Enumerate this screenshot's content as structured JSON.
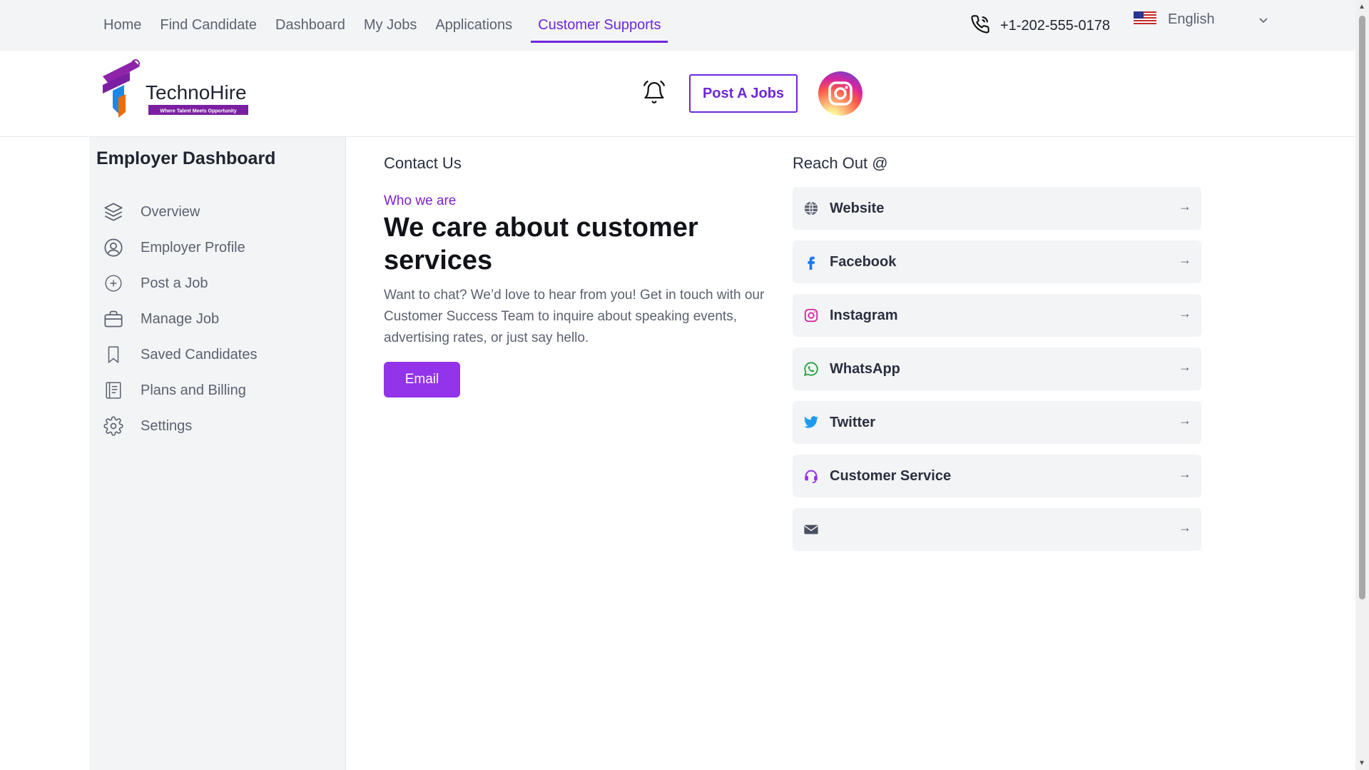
{
  "nav": {
    "items": [
      "Home",
      "Find Candidate",
      "Dashboard",
      "My Jobs",
      "Applications",
      "Customer Supports"
    ],
    "active": "Customer Supports",
    "phone": "+1-202-555-0178",
    "language": "English"
  },
  "header": {
    "logo_name": "TechnoHire",
    "logo_tagline": "Where Talent Meets Opportunity",
    "post_button": "Post A Jobs"
  },
  "sidebar": {
    "title": "Employer Dashboard",
    "items": [
      {
        "label": "Overview",
        "icon": "layers-icon"
      },
      {
        "label": "Employer Profile",
        "icon": "user-circle-icon"
      },
      {
        "label": "Post a Job",
        "icon": "plus-circle-icon"
      },
      {
        "label": "Manage Job",
        "icon": "briefcase-icon"
      },
      {
        "label": "Saved Candidates",
        "icon": "bookmark-icon"
      },
      {
        "label": "Plans and Billing",
        "icon": "billing-icon"
      },
      {
        "label": "Settings",
        "icon": "gear-icon"
      }
    ]
  },
  "contact": {
    "title": "Contact Us",
    "eyebrow": "Who we are",
    "headline": "We care about customer services",
    "description": "Want to chat? We’d love to hear from you! Get in touch with our Customer Success Team to inquire about speaking events, advertising rates, or just say hello.",
    "email_button": "Email"
  },
  "reach": {
    "title": "Reach Out @",
    "items": [
      {
        "label": "Website",
        "icon": "globe-icon"
      },
      {
        "label": "Facebook",
        "icon": "facebook-icon"
      },
      {
        "label": "Instagram",
        "icon": "instagram-icon"
      },
      {
        "label": "WhatsApp",
        "icon": "whatsapp-icon"
      },
      {
        "label": "Twitter",
        "icon": "twitter-icon"
      },
      {
        "label": "Customer Service",
        "icon": "headset-icon"
      },
      {
        "label": "",
        "icon": "envelope-icon"
      }
    ],
    "arrow": "→"
  },
  "colors": {
    "accent": "#6d28d9",
    "button": "#9333ea",
    "panel": "#f3f4f6"
  }
}
